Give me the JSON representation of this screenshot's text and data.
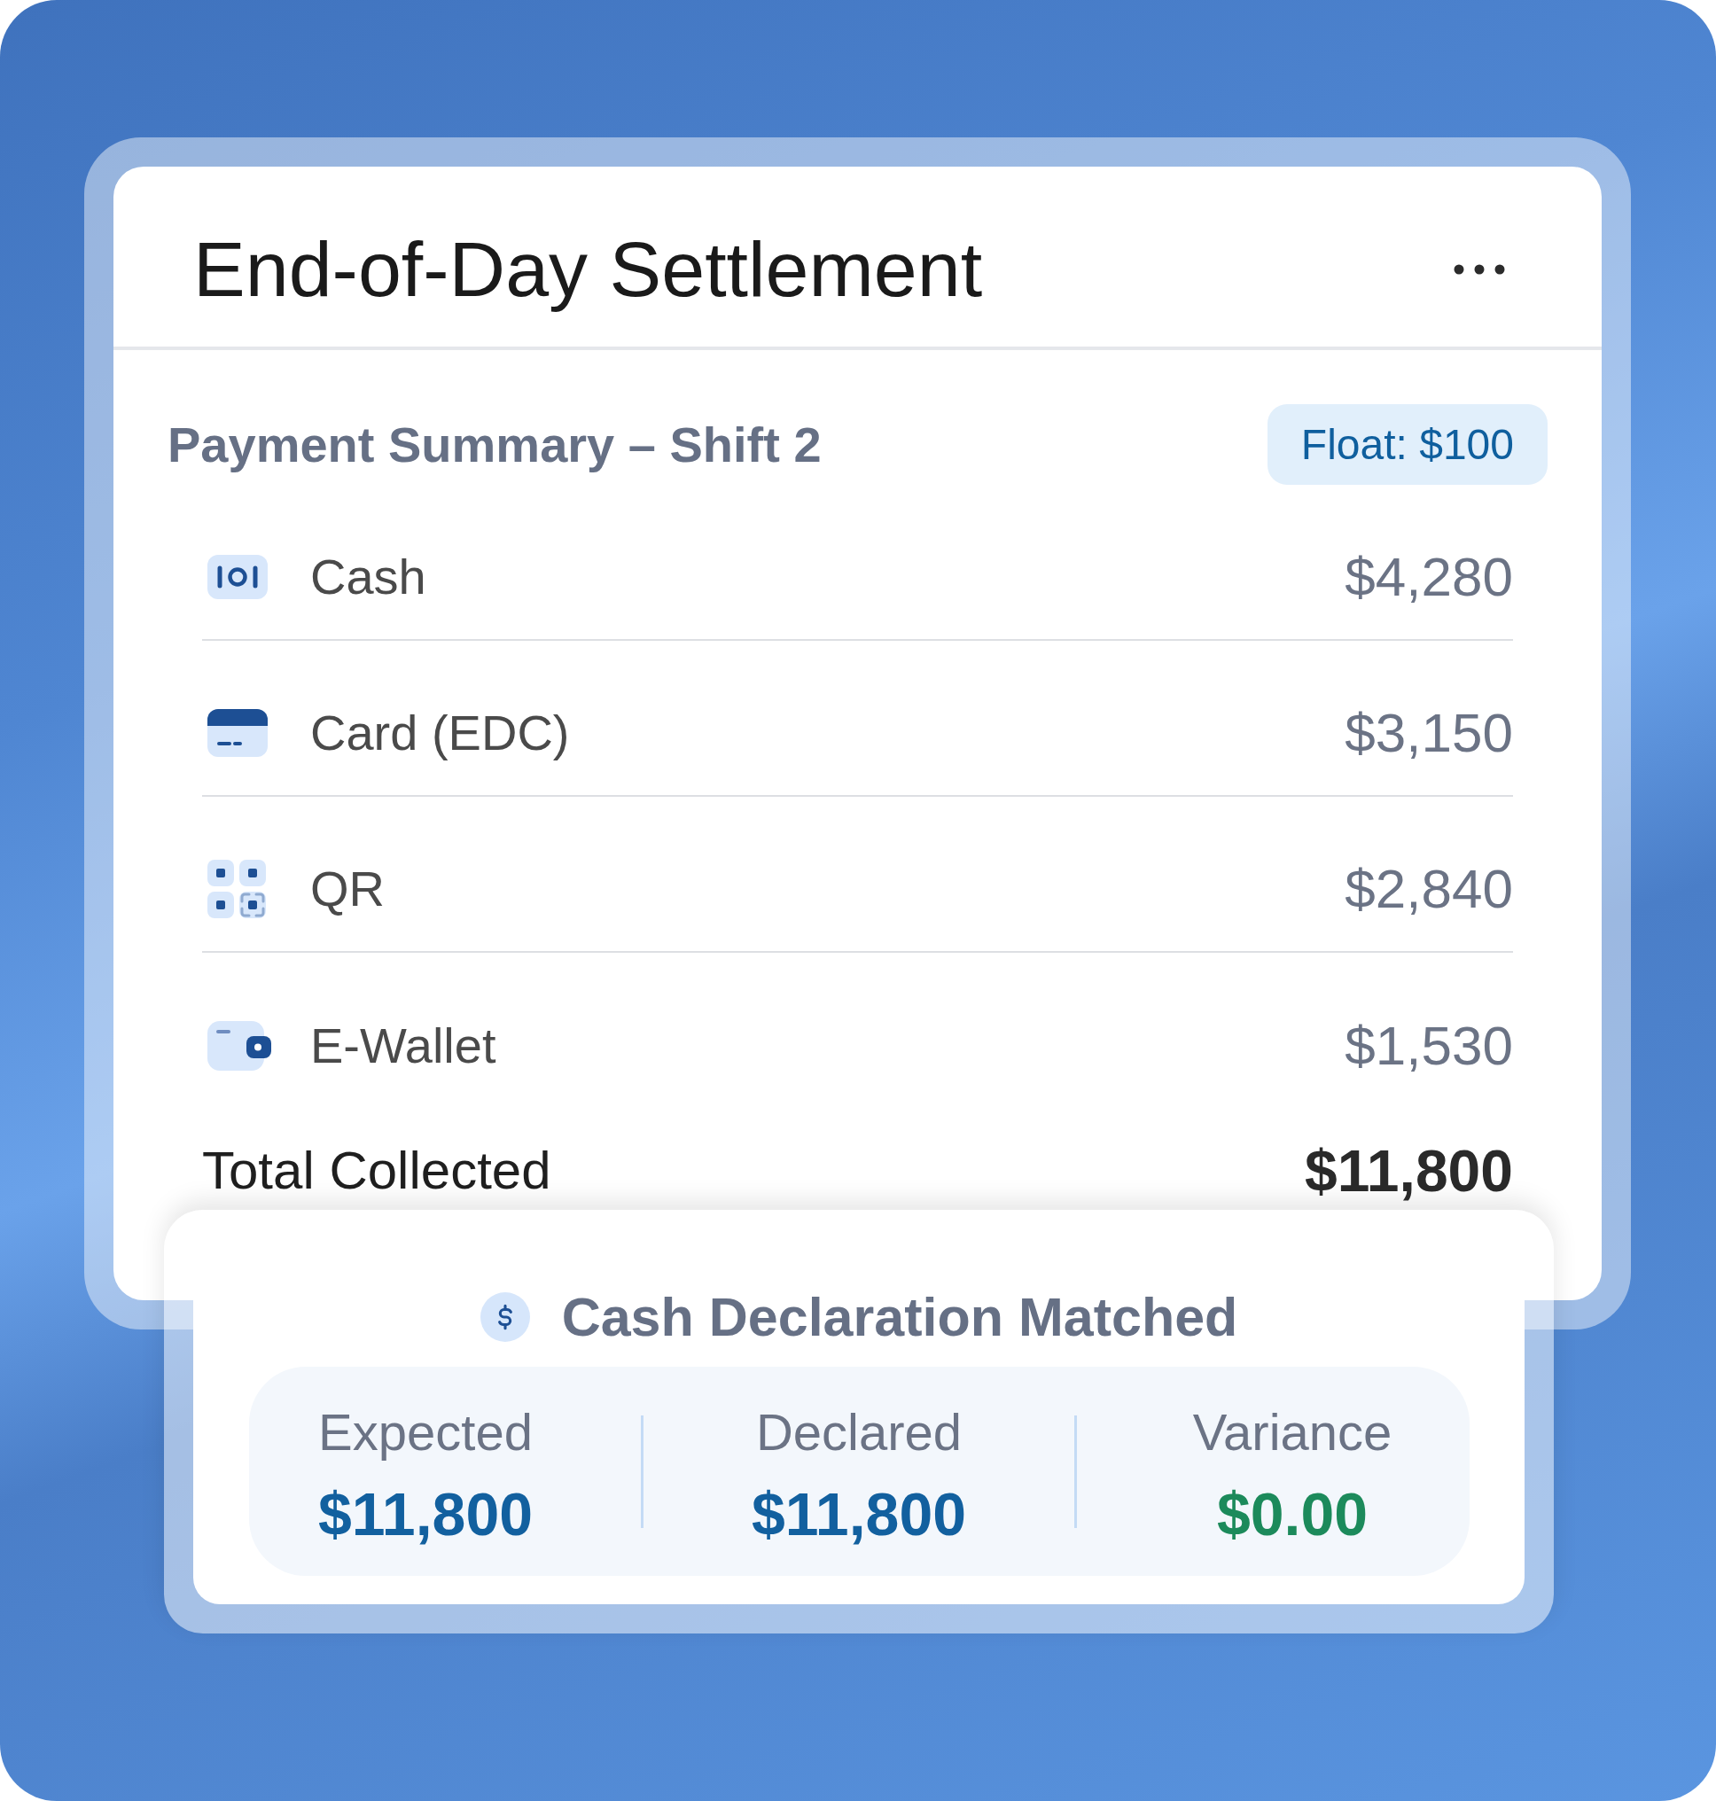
{
  "header": {
    "title": "End-of-Day Settlement"
  },
  "summary": {
    "title": "Payment Summary – Shift 2",
    "badge": "Float: $100"
  },
  "payments": [
    {
      "kind": "cash",
      "label": "Cash",
      "amount": "$4,280"
    },
    {
      "kind": "card",
      "label": "Card (EDC)",
      "amount": "$3,150"
    },
    {
      "kind": "qr",
      "label": "QR",
      "amount": "$2,840"
    },
    {
      "kind": "wallet",
      "label": "E-Wallet",
      "amount": "$1,530"
    }
  ],
  "total": {
    "label": "Total Collected",
    "amount": "$11,800"
  },
  "declaration": {
    "title": "Cash Declaration Matched",
    "stats": [
      {
        "label": "Expected",
        "value": "$11,800",
        "color": "#12609f"
      },
      {
        "label": "Declared",
        "value": "$11,800",
        "color": "#12609f"
      },
      {
        "label": "Variance",
        "value": "$0.00",
        "color": "#1c8a5b"
      }
    ]
  }
}
